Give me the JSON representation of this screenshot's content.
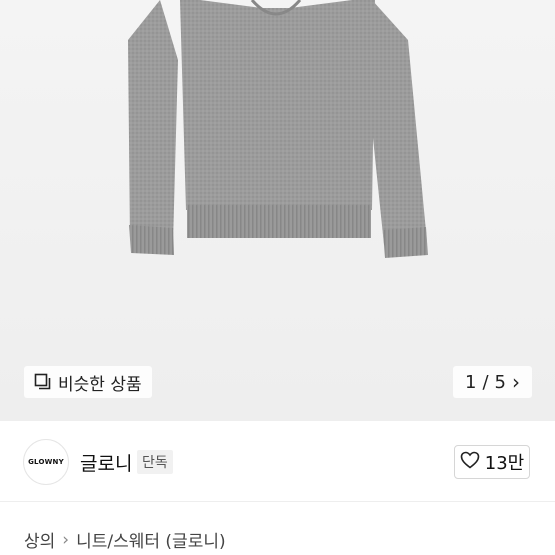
{
  "image": {
    "similar_label": "비슷한 상품",
    "pager": {
      "current": "1",
      "separator": "/",
      "total": "5"
    }
  },
  "brand": {
    "logo_text": "GLOWNY",
    "name": "글로니",
    "badge": "단독",
    "likes": "13만"
  },
  "breadcrumb": {
    "category": "상의",
    "subcategory": "니트/스웨터 (글로니)"
  },
  "colors": {
    "sweater": "#9a9a9a",
    "image_bg": "#efefef"
  }
}
